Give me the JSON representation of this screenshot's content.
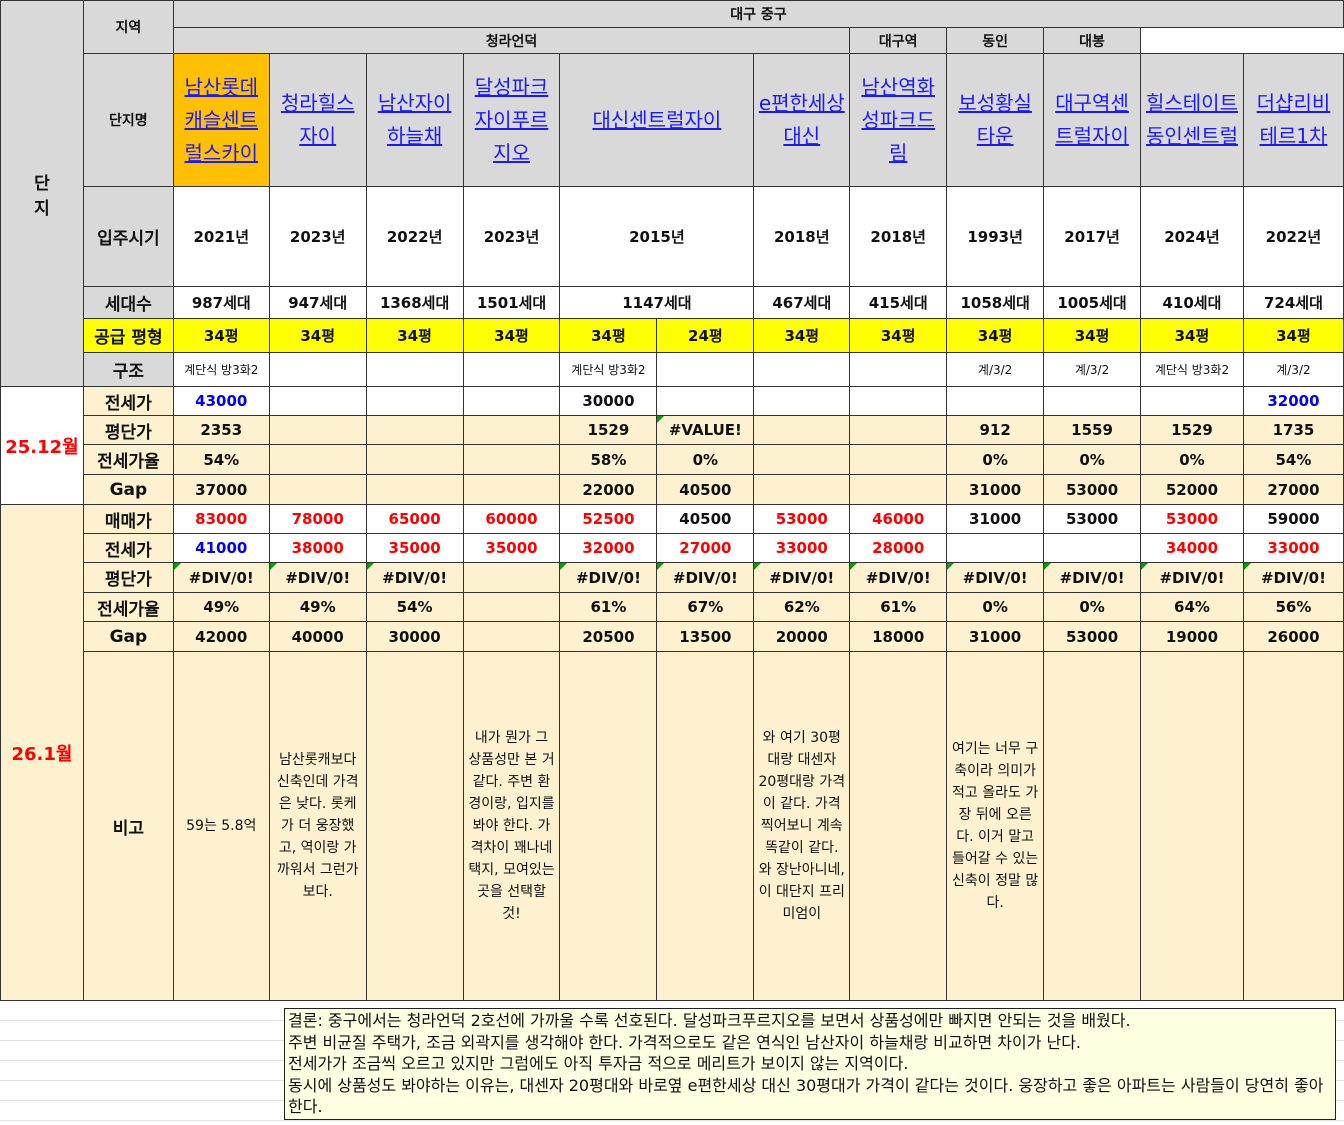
{
  "header": {
    "complex": "단\n지",
    "region_label": "지역",
    "region": "대구 중구",
    "name_label": "단지명",
    "subregions": [
      "청라언덕",
      "대구역",
      "동인",
      "대봉"
    ]
  },
  "complexes": [
    {
      "name": "남산롯데캐슬센트럴스카이",
      "year": "2021년",
      "households": "987세대",
      "structure": "계단식 방3화2"
    },
    {
      "name": "청라힐스자이",
      "year": "2023년",
      "households": "947세대",
      "structure": ""
    },
    {
      "name": "남산자이하늘채",
      "year": "2022년",
      "households": "1368세대",
      "structure": ""
    },
    {
      "name": "달성파크자이푸르지오",
      "year": "2023년",
      "households": "1501세대",
      "structure": ""
    },
    {
      "name": "대신센트럴자이",
      "year": "2015년",
      "households": "1147세대",
      "structure": "계단식 방3화2"
    },
    {
      "name": "e편한세상대신",
      "year": "2018년",
      "households": "467세대",
      "structure": ""
    },
    {
      "name": "남산역화성파크드림",
      "year": "2018년",
      "households": "415세대",
      "structure": ""
    },
    {
      "name": "보성황실타운",
      "year": "1993년",
      "households": "1058세대",
      "structure": "계/3/2"
    },
    {
      "name": "대구역센트럴자이",
      "year": "2017년",
      "households": "1005세대",
      "structure": "계/3/2"
    },
    {
      "name": "힐스테이트동인센트럴",
      "year": "2024년",
      "households": "410세대",
      "structure": "계단식 방3화2"
    },
    {
      "name": "더샵리비테르1차",
      "year": "2022년",
      "households": "724세대",
      "structure": "계/3/2"
    }
  ],
  "row_labels": {
    "year": "입주시기",
    "households": "세대수",
    "size": "공급 평형",
    "structure": "구조",
    "jeonse": "전세가",
    "per_pyeong": "평단가",
    "ratio": "전세가율",
    "gap": "Gap",
    "sale": "매매가",
    "remarks": "비고"
  },
  "sizes": [
    "34평",
    "34평",
    "34평",
    "34평",
    "34평",
    "24평",
    "34평",
    "34평",
    "34평",
    "34평",
    "34평",
    "34평"
  ],
  "periods": [
    {
      "label": "25.12월",
      "jeonse": [
        "43000",
        "",
        "",
        "",
        "30000",
        "",
        "",
        "",
        "",
        "",
        "",
        "32000"
      ],
      "per_pyeong": [
        "2353",
        "",
        "",
        "",
        "1529",
        "#VALUE!",
        "",
        "",
        "912",
        "1559",
        "1529",
        "1735"
      ],
      "ratio": [
        "54%",
        "",
        "",
        "",
        "58%",
        "0%",
        "",
        "",
        "0%",
        "0%",
        "0%",
        "54%"
      ],
      "gap": [
        "37000",
        "",
        "",
        "",
        "22000",
        "40500",
        "",
        "",
        "31000",
        "53000",
        "52000",
        "27000"
      ]
    },
    {
      "label": "26.1월",
      "sale": [
        "83000",
        "78000",
        "65000",
        "60000",
        "52500",
        "40500",
        "53000",
        "46000",
        "31000",
        "53000",
        "53000",
        "59000"
      ],
      "jeonse": [
        "41000",
        "38000",
        "35000",
        "35000",
        "32000",
        "27000",
        "33000",
        "28000",
        "",
        "",
        "34000",
        "33000"
      ],
      "per_pyeong": [
        "#DIV/0!",
        "#DIV/0!",
        "#DIV/0!",
        "",
        "#DIV/0!",
        "#DIV/0!",
        "#DIV/0!",
        "#DIV/0!",
        "#DIV/0!",
        "#DIV/0!",
        "#DIV/0!",
        "#DIV/0!"
      ],
      "ratio": [
        "49%",
        "49%",
        "54%",
        "",
        "61%",
        "67%",
        "62%",
        "61%",
        "0%",
        "0%",
        "64%",
        "56%"
      ],
      "gap": [
        "42000",
        "40000",
        "30000",
        "",
        "20500",
        "13500",
        "20000",
        "18000",
        "31000",
        "53000",
        "19000",
        "26000"
      ],
      "remarks": [
        "59는 5.8억",
        "남산롯캐보다 신축인데 가격은 낮다. 롯케가 더 웅장했고, 역이랑 가까워서 그런가보다.",
        "",
        "내가 뭔가 그 상품성만 본 거 같다. 주변 환경이랑, 입지를 봐야 한다. 가격차이 꽤나네 택지, 모여있는곳을 선택할 것!",
        "",
        "",
        "와 여기 30평대랑 대센자 20평대랑 가격이 같다. 가격 찍어보니 계속 똑같이 같다. 와 장난아니네, 이 대단지 프리미엄이",
        "",
        "여기는 너무 구축이라 의미가 적고 올라도 가장 뒤에 오른다. 이거 말고 들어갈 수 있는 신축이 정말 많다.",
        "",
        "",
        ""
      ]
    }
  ],
  "colors": {
    "sale_red": [
      "r",
      "r",
      "r",
      "r",
      "r",
      "k",
      "r",
      "r",
      "k",
      "k",
      "r",
      "k"
    ],
    "jeonse_color_1": [
      "b",
      "",
      "",
      "",
      "k",
      "",
      "",
      "",
      "",
      "",
      "",
      "b"
    ],
    "jeonse_color_2": [
      "b",
      "r",
      "r",
      "r",
      "r",
      "r",
      "r",
      "r",
      "",
      "",
      "r",
      "r"
    ]
  },
  "conclusion": [
    "결론: 중구에서는 청라언덕 2호선에 가까울 수록 선호된다. 달성파크푸르지오를 보면서 상품성에만 빠지면 안되는 것을 배웠다.",
    "주변 비균질 주택가, 조금 외곽지를 생각해야 한다. 가격적으로도 같은 연식인 남산자이 하늘채랑 비교하면 차이가 난다.",
    "전세가가 조금씩 오르고 있지만 그럼에도 아직 투자금 적으로 메리트가 보이지 않는 지역이다.",
    "동시에 상품성도 봐야하는 이유는, 대센자 20평대와 바로옆 e편한세상 대신 30평대가 가격이 같다는 것이다. 웅장하고 좋은 아파트는 사람들이 당연히 좋아한다."
  ]
}
